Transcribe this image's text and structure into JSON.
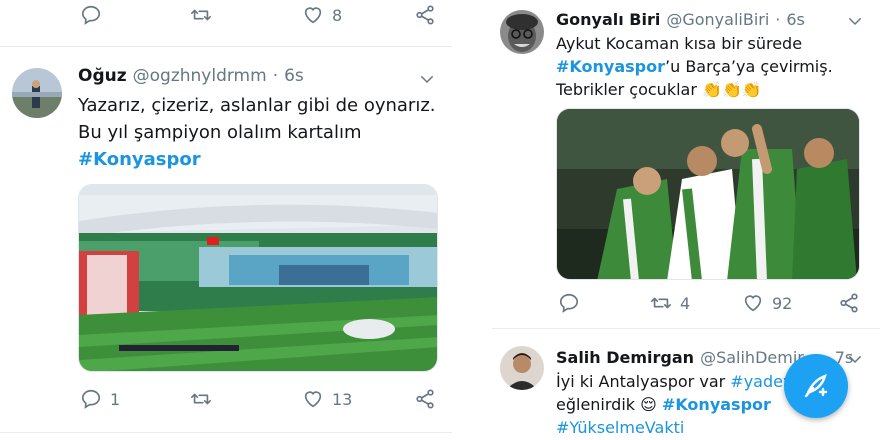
{
  "left": {
    "top_actions": {
      "likes": "8"
    },
    "tweet": {
      "name": "Oğuz",
      "handle": "@ogzhnyldrmm",
      "dot": "·",
      "time": "6s",
      "line1": "Yazarız, çizeriz, aslanlar gibi de oynarız.",
      "line2": "Bu yıl şampiyon olalım kartalım",
      "hashtag": "#Konyaspor",
      "replies": "1",
      "likes": "13"
    }
  },
  "right": {
    "tweet1": {
      "name": "Gonyalı Biri",
      "handle": "@GonyaliBiri",
      "dot": "·",
      "time": "6s",
      "line1": "Aykut Kocaman kısa bir sürede",
      "hashtag": "#Konyaspor",
      "line2_rest": "’u Barça’ya çevirmiş.",
      "line3": "Tebrikler çocuklar",
      "emoji": "👏👏👏",
      "retweets": "4",
      "likes": "92"
    },
    "tweet2": {
      "name": "Salih Demirgan",
      "handle": "@SalihDemir...",
      "dot": "·",
      "time": "7s",
      "line1_pre": "İyi ki Antalyaspor var ",
      "hashtag1": "#yadeyse",
      "line2_pre": "eğlenirdik ",
      "emoji": "😌",
      "hashtag2": "#Konyaspor",
      "hashtag3": "#YükselmeVakti"
    }
  },
  "colors": {
    "accent": "#1da1f2",
    "link": "#1b95e0",
    "muted": "#657786",
    "divider": "#e6ecf0"
  },
  "icons": [
    "reply-icon",
    "retweet-icon",
    "like-icon",
    "share-icon",
    "chevron-down-icon",
    "compose-icon"
  ]
}
